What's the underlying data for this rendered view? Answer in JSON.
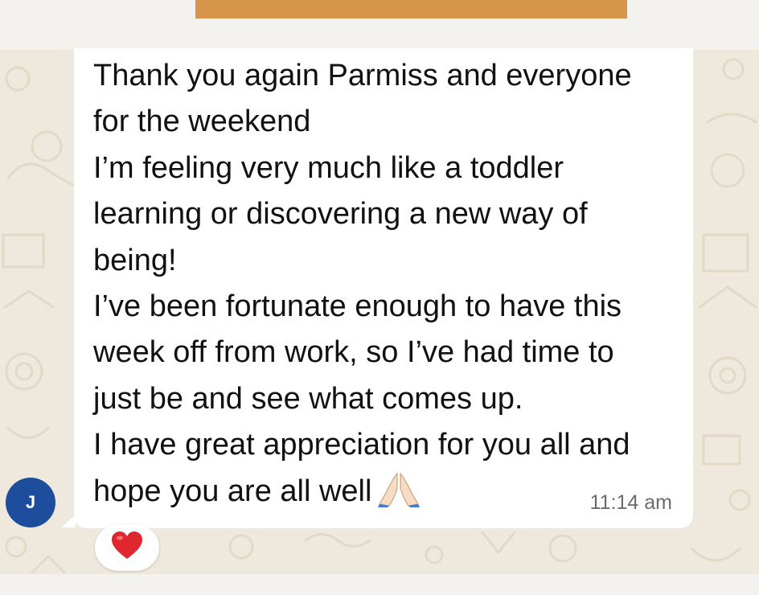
{
  "message": {
    "lines": [
      "Thank you again Parmiss and everyone",
      "for the weekend",
      "I’m feeling very much like a toddler",
      "learning or discovering a new way of",
      "being!",
      "I’ve been fortunate enough to have this",
      "week off from work, so I’ve had time to",
      "just be and see what comes up.",
      "I have great appreciation for you all and",
      "hope you are all well"
    ],
    "trailing_emoji": "folded-hands-emoji",
    "timestamp": "11:14 am"
  },
  "sender": {
    "avatar_initial": "J",
    "avatar_color": "#1d4d9c"
  },
  "reaction": {
    "emoji": "red-heart-emoji",
    "color": "#e0262f"
  },
  "colors": {
    "wallpaper": "#efe9dd",
    "bubble": "#ffffff",
    "previous_bubble": "#d5954a",
    "timestamp": "#6b6b6b"
  }
}
